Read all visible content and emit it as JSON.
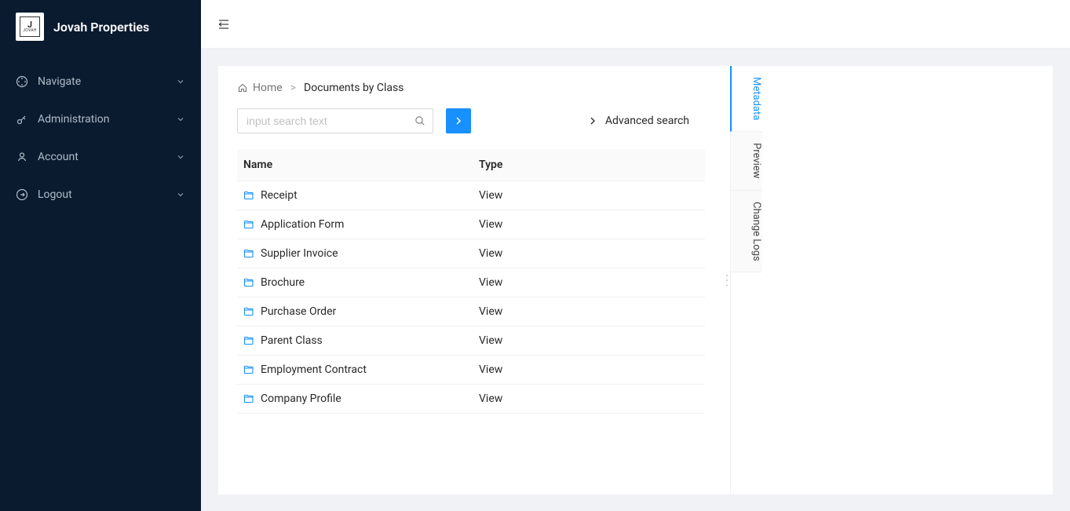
{
  "brand": "Jovah Properties",
  "sidebar": {
    "items": [
      {
        "label": "Navigate",
        "icon": "compass"
      },
      {
        "label": "Administration",
        "icon": "key"
      },
      {
        "label": "Account",
        "icon": "user"
      },
      {
        "label": "Logout",
        "icon": "logout"
      }
    ]
  },
  "breadcrumb": {
    "home": "Home",
    "current": "Documents by Class"
  },
  "search": {
    "placeholder": "input search text",
    "advanced": "Advanced search"
  },
  "table": {
    "headers": {
      "name": "Name",
      "type": "Type"
    },
    "rows": [
      {
        "name": "Receipt",
        "type": "View"
      },
      {
        "name": "Application Form",
        "type": "View"
      },
      {
        "name": "Supplier Invoice",
        "type": "View"
      },
      {
        "name": "Brochure",
        "type": "View"
      },
      {
        "name": "Purchase Order",
        "type": "View"
      },
      {
        "name": "Parent Class",
        "type": "View"
      },
      {
        "name": "Employment Contract",
        "type": "View"
      },
      {
        "name": "Company Profile",
        "type": "View"
      }
    ]
  },
  "side_tabs": {
    "metadata": "Metadata",
    "preview": "Preview",
    "change_logs": "Change Logs"
  }
}
